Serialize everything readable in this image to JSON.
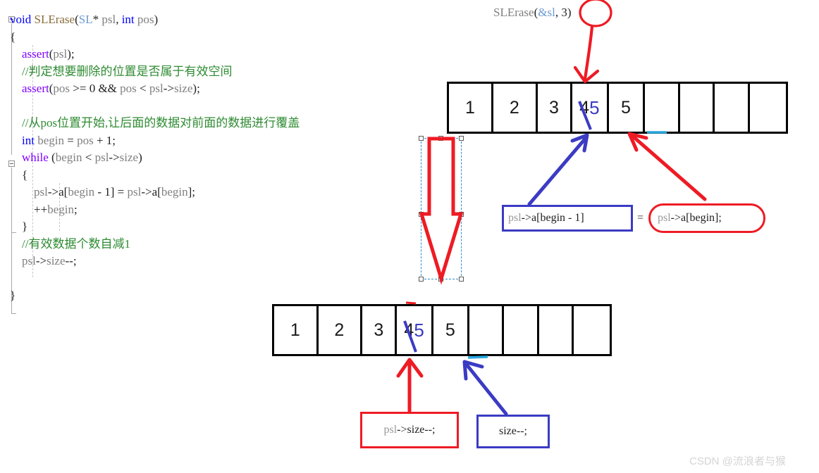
{
  "watermark": "CSDN @流浪者与猴",
  "code": {
    "lines": [
      [
        {
          "t": "void ",
          "c": "kw"
        },
        {
          "t": "SLErase",
          "c": "fn"
        },
        {
          "t": "(",
          "c": "pun"
        },
        {
          "t": "SL",
          "c": "type"
        },
        {
          "t": "* ",
          "c": "pun"
        },
        {
          "t": "psl",
          "c": "id"
        },
        {
          "t": ", ",
          "c": "pun"
        },
        {
          "t": "int ",
          "c": "kw"
        },
        {
          "t": "pos",
          "c": "id"
        },
        {
          "t": ")",
          "c": "pun"
        }
      ],
      [
        {
          "t": "{",
          "c": "pun"
        }
      ],
      [
        {
          "t": "    ",
          "c": "pun"
        },
        {
          "t": "assert",
          "c": "kw2"
        },
        {
          "t": "(",
          "c": "pun"
        },
        {
          "t": "psl",
          "c": "id"
        },
        {
          "t": ");",
          "c": "pun"
        }
      ],
      [
        {
          "t": "    ",
          "c": "pun"
        },
        {
          "t": "//判定想要删除的位置是否属于有效空间",
          "c": "cmt"
        }
      ],
      [
        {
          "t": "    ",
          "c": "pun"
        },
        {
          "t": "assert",
          "c": "kw2"
        },
        {
          "t": "(",
          "c": "pun"
        },
        {
          "t": "pos ",
          "c": "id"
        },
        {
          "t": ">= ",
          "c": "pun"
        },
        {
          "t": "0",
          "c": "num"
        },
        {
          "t": " && ",
          "c": "pun"
        },
        {
          "t": "pos ",
          "c": "id"
        },
        {
          "t": "< ",
          "c": "pun"
        },
        {
          "t": "psl",
          "c": "id"
        },
        {
          "t": "->",
          "c": "pun"
        },
        {
          "t": "size",
          "c": "id"
        },
        {
          "t": ");",
          "c": "pun"
        }
      ],
      [],
      [
        {
          "t": "    ",
          "c": "pun"
        },
        {
          "t": "//从pos位置开始,让后面的数据对前面的数据进行覆盖",
          "c": "cmt"
        }
      ],
      [
        {
          "t": "    ",
          "c": "pun"
        },
        {
          "t": "int ",
          "c": "kw"
        },
        {
          "t": "begin ",
          "c": "id"
        },
        {
          "t": "= ",
          "c": "pun"
        },
        {
          "t": "pos ",
          "c": "id"
        },
        {
          "t": "+ ",
          "c": "pun"
        },
        {
          "t": "1",
          "c": "num"
        },
        {
          "t": ";",
          "c": "pun"
        }
      ],
      [
        {
          "t": "    ",
          "c": "pun"
        },
        {
          "t": "while ",
          "c": "kw2"
        },
        {
          "t": "(",
          "c": "pun"
        },
        {
          "t": "begin ",
          "c": "id"
        },
        {
          "t": "< ",
          "c": "pun"
        },
        {
          "t": "psl",
          "c": "id"
        },
        {
          "t": "->",
          "c": "pun"
        },
        {
          "t": "size",
          "c": "id"
        },
        {
          "t": ")",
          "c": "pun"
        }
      ],
      [
        {
          "t": "    {",
          "c": "pun"
        }
      ],
      [
        {
          "t": "        ",
          "c": "pun"
        },
        {
          "t": "psl",
          "c": "id"
        },
        {
          "t": "->",
          "c": "pun"
        },
        {
          "t": "a",
          "c": "d"
        },
        {
          "t": "[",
          "c": "pun"
        },
        {
          "t": "begin ",
          "c": "id"
        },
        {
          "t": "- ",
          "c": "pun"
        },
        {
          "t": "1",
          "c": "num"
        },
        {
          "t": "] = ",
          "c": "pun"
        },
        {
          "t": "psl",
          "c": "id"
        },
        {
          "t": "->",
          "c": "pun"
        },
        {
          "t": "a",
          "c": "d"
        },
        {
          "t": "[",
          "c": "pun"
        },
        {
          "t": "begin",
          "c": "id"
        },
        {
          "t": "];",
          "c": "pun"
        }
      ],
      [
        {
          "t": "        ",
          "c": "pun"
        },
        {
          "t": "++",
          "c": "pun"
        },
        {
          "t": "begin",
          "c": "id"
        },
        {
          "t": ";",
          "c": "pun"
        }
      ],
      [
        {
          "t": "    }",
          "c": "pun"
        }
      ],
      [
        {
          "t": "    ",
          "c": "pun"
        },
        {
          "t": "//有效数据个数自减1",
          "c": "cmt"
        }
      ],
      [
        {
          "t": "    ",
          "c": "pun"
        },
        {
          "t": "psl",
          "c": "id"
        },
        {
          "t": "->",
          "c": "pun"
        },
        {
          "t": "size",
          "c": "id"
        },
        {
          "t": "--;",
          "c": "pun"
        }
      ],
      [],
      [
        {
          "t": "}",
          "c": "pun"
        }
      ]
    ]
  },
  "call_annotation": {
    "prefix": "SLErase",
    "open": "(",
    "arg1": "&sl",
    "comma": ", ",
    "arg2": "3",
    "close": ")",
    "circled_value": "3",
    "circle_color": "#ee1b24"
  },
  "arrays": [
    {
      "name": "array-top",
      "cells": [
        {
          "old": "1",
          "new": ""
        },
        {
          "old": "2",
          "new": ""
        },
        {
          "old": "3",
          "new": ""
        },
        {
          "old": "4",
          "new": "5",
          "struck": true
        },
        {
          "old": "5",
          "new": ""
        },
        {
          "old": "",
          "new": ""
        },
        {
          "old": "",
          "new": ""
        },
        {
          "old": "",
          "new": ""
        },
        {
          "old": "",
          "new": ""
        }
      ]
    },
    {
      "name": "array-bottom",
      "cells": [
        {
          "old": "1",
          "new": ""
        },
        {
          "old": "2",
          "new": ""
        },
        {
          "old": "3",
          "new": ""
        },
        {
          "old": "4",
          "new": "5",
          "struck": true
        },
        {
          "old": "5",
          "new": ""
        },
        {
          "old": "",
          "new": ""
        },
        {
          "old": "",
          "new": ""
        },
        {
          "old": "",
          "new": ""
        },
        {
          "old": "",
          "new": ""
        }
      ]
    }
  ],
  "callouts": {
    "assign_left": {
      "grey": "psl",
      "arrow": "->",
      "rest": "a[begin - 1]"
    },
    "equals": "=",
    "assign_right": {
      "grey": "psl",
      "arrow": "->",
      "rest": "a[begin];"
    },
    "size_dec_full": {
      "grey": "psl",
      "arrow": "->",
      "rest": "size--;"
    },
    "size_dec_short": {
      "rest": "size--;"
    }
  },
  "colors": {
    "red": "#ee1b24",
    "blue": "#3b3bc4",
    "selection": "#2e8bd0",
    "comment_green": "#2e8b32",
    "keyword_blue": "#0000ff",
    "keyword_purple": "#8000ff",
    "identifier_grey": "#808080"
  }
}
